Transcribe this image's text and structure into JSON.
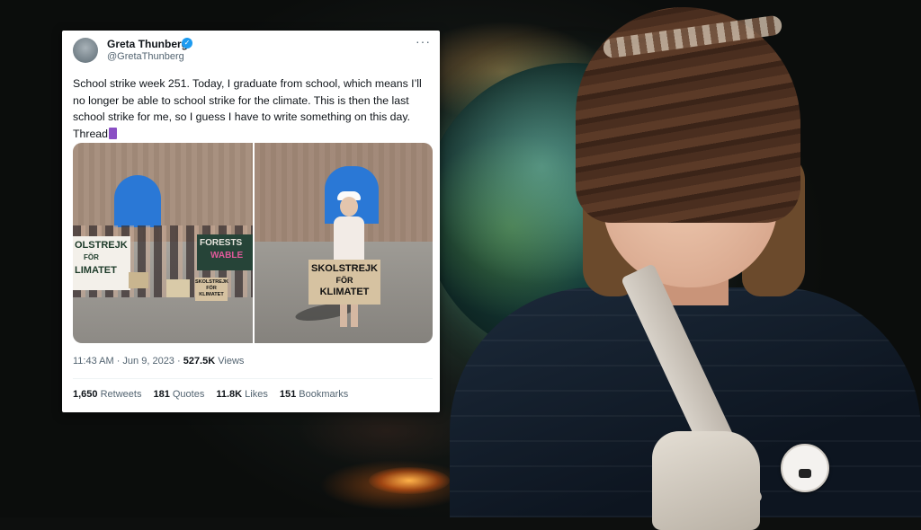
{
  "tweet": {
    "author_name": "Greta Thunberg",
    "author_handle": "@GretaThunberg",
    "more_label": "···",
    "text": "School strike week 251. Today, I graduate from school, which means I’ll no longer be able to school strike for the climate. This is then the last school strike for me, so I guess I have to write something on this day. Thread",
    "timestamp": "11:43 AM · Jun 9, 2023 · ",
    "views_count": "527.5K",
    "views_label": " Views",
    "stats": {
      "retweets_count": "1,650",
      "retweets_label": " Retweets",
      "quotes_count": "181",
      "quotes_label": " Quotes",
      "likes_count": "11.8K",
      "likes_label": " Likes",
      "bookmarks_count": "151",
      "bookmarks_label": " Bookmarks"
    },
    "photo1": {
      "banner_left_line1": "OLSTREJK",
      "banner_left_line2": "FÖR",
      "banner_left_line3": "LIMATET",
      "banner_right_line1": "FORESTS",
      "banner_right_line2": "WABLE",
      "sign_line1": "SKOLSTREJK",
      "sign_line2": "FÖR",
      "sign_line3": "KLIMATET"
    },
    "photo2": {
      "sign_line1": "SKOLSTREJK",
      "sign_line2": "FÖR",
      "sign_line3": "KLIMATET"
    }
  },
  "colors": {
    "verified_blue": "#1d9bf0",
    "text_primary": "#0f1419",
    "text_secondary": "#536471"
  },
  "icons": {
    "verified": "verified-badge-icon",
    "more": "more-dots-icon",
    "thread": "thread-emoji-icon"
  }
}
